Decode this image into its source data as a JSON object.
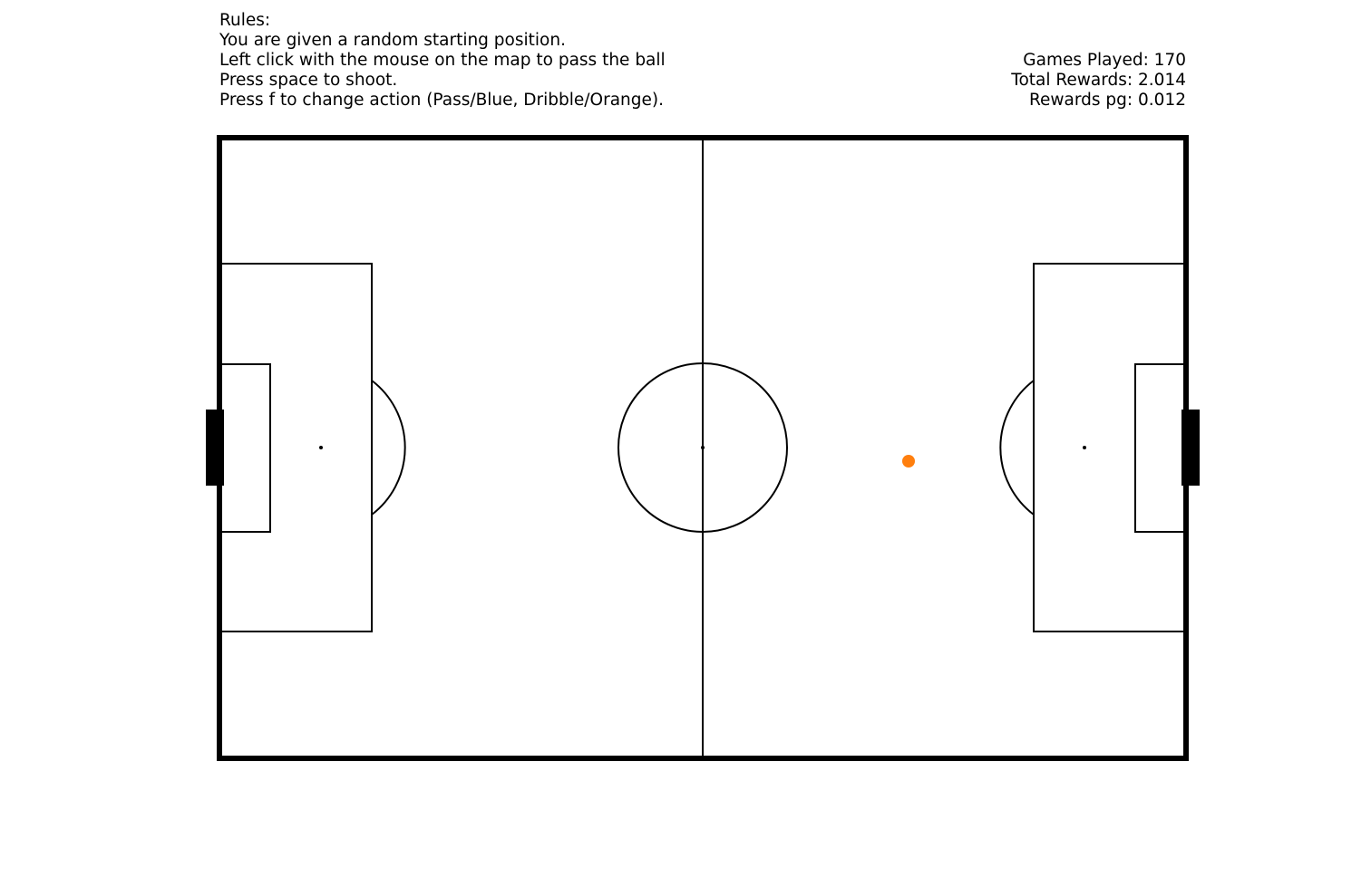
{
  "rules": {
    "heading": "Rules:",
    "line1": "You are given a random starting position.",
    "line2": "Left click with the mouse on the map to pass the ball",
    "line3": "Press space to shoot.",
    "line4": "Press f to change action (Pass/Blue, Dribble/Orange)."
  },
  "stats": {
    "games_played": "Games Played: 170",
    "total_rewards": "Total Rewards: 2.014",
    "rewards_pg": "Rewards pg: 0.012"
  },
  "pitch": {
    "line_color": "#000000",
    "background": "#ffffff"
  },
  "ball": {
    "color": "#ff7f0e",
    "mode": "Dribble"
  }
}
